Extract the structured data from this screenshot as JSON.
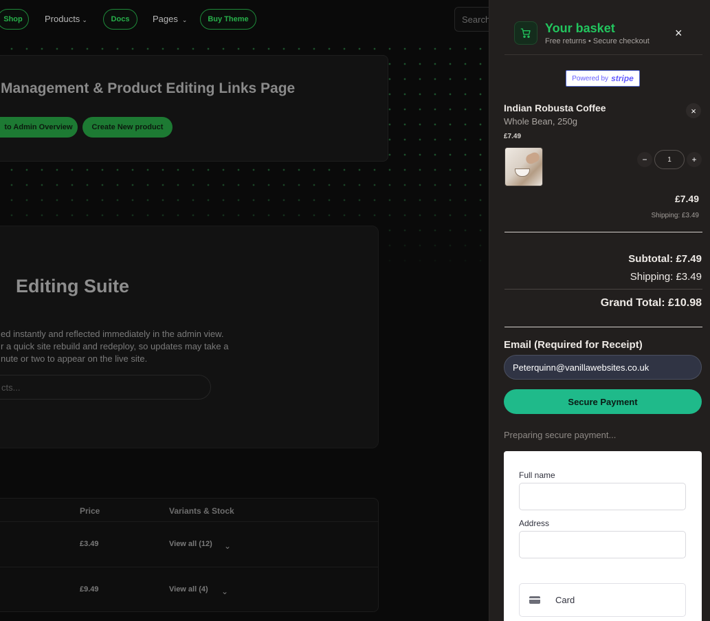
{
  "nav": {
    "shop": "Shop",
    "products": "Products",
    "docs": "Docs",
    "pages": "Pages",
    "buy_theme": "Buy Theme",
    "search_placeholder": "Search"
  },
  "admin_header": {
    "title": "Management & Product Editing Links Page",
    "back_button": "to Admin Overview",
    "create_button": "Create New product"
  },
  "editing_suite": {
    "heading": "Editing Suite",
    "line1": "ed instantly and reflected immediately in the admin view.",
    "line2": "r a quick site rebuild and redeploy, so updates may take a",
    "line3": "nute or two to appear on the live site.",
    "search_placeholder": "cts..."
  },
  "table": {
    "headers": {
      "price": "Price",
      "variants": "Variants & Stock"
    },
    "rows": [
      {
        "price": "£3.49",
        "variants": "View all (12)"
      },
      {
        "price": "£9.49",
        "variants": "View all (4)"
      }
    ]
  },
  "cart": {
    "title": "Your basket",
    "subtitle": "Free returns • Secure checkout",
    "close": "×",
    "stripe": {
      "powered": "Powered by",
      "brand": "stripe"
    },
    "item": {
      "name": "Indian Robusta Coffee",
      "variant": "Whole Bean, 250g",
      "unit_price": "£7.49",
      "quantity": "1",
      "minus": "−",
      "plus": "+",
      "remove": "×",
      "line_total": "£7.49",
      "line_shipping": "Shipping: £3.49"
    },
    "totals": {
      "subtotal": "Subtotal: £7.49",
      "shipping": "Shipping: £3.49",
      "grand_total": "Grand Total: £10.98"
    },
    "email": {
      "label": "Email (Required for Receipt)",
      "value": "Peterquinn@vanillawebsites.co.uk"
    },
    "pay_button": "Secure Payment",
    "status": "Preparing secure payment...",
    "payment_form": {
      "full_name_label": "Full name",
      "address_label": "Address",
      "card_tab": "Card"
    }
  },
  "colors": {
    "accent_green": "#22c55e",
    "pay_button": "#1fba8a",
    "drawer_bg": "#221f1e",
    "admin_button": "#1d7a33"
  }
}
